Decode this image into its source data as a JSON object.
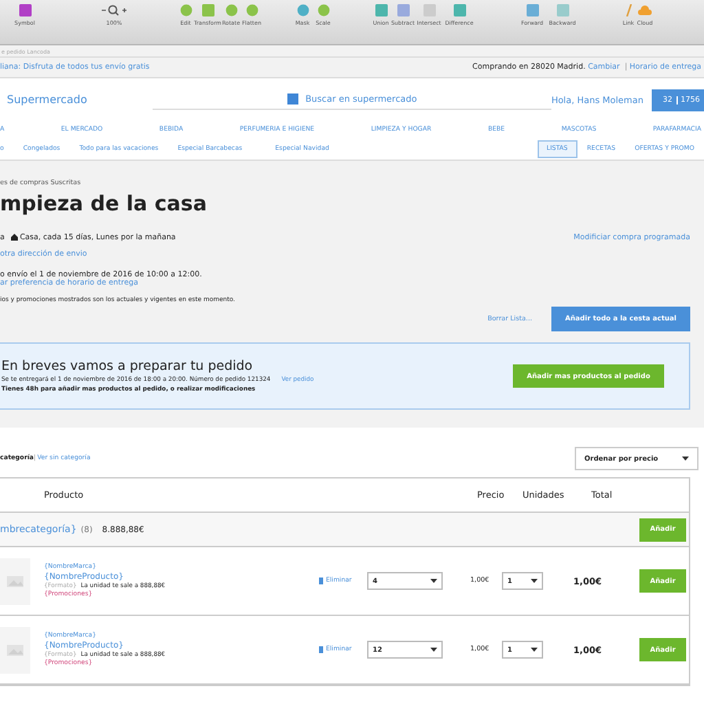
{
  "toolbar": {
    "items": [
      {
        "label": "Symbol"
      },
      {
        "label": "100%"
      },
      {
        "label": "Edit"
      },
      {
        "label": "Transform"
      },
      {
        "label": "Rotate"
      },
      {
        "label": "Flatten"
      },
      {
        "label": "Mask"
      },
      {
        "label": "Scale"
      },
      {
        "label": "Union"
      },
      {
        "label": "Subtract"
      },
      {
        "label": "Intersect"
      },
      {
        "label": "Difference"
      },
      {
        "label": "Forward"
      },
      {
        "label": "Backward"
      },
      {
        "label": "Link"
      },
      {
        "label": "Cloud"
      }
    ]
  },
  "artboard_label": "e pedido Lancoda",
  "promo_bar": {
    "message": "liana: Disfruta de todos tus envío gratis",
    "location": "Comprando en 28020 Madrid.",
    "change_link": "Cambiar",
    "separator": "|",
    "schedule_link": "Horario de entrega"
  },
  "header": {
    "logo": "Supermercado",
    "search": {
      "placeholder": "Buscar en supermercado"
    },
    "greeting": "Hola, Hans Moleman",
    "cart": {
      "count": "32",
      "total": "1756"
    }
  },
  "nav_primary": [
    "A",
    "EL MERCADO",
    "BEBIDA",
    "PERFUMERIA E HIGIENE",
    "LIMPIEZA Y HOGAR",
    "BEBE",
    "MASCOTAS",
    "PARAFARMACIA"
  ],
  "nav_secondary": {
    "left": [
      "o",
      "Congelados",
      "Todo para las vacaciones",
      "Especial Barcabecas",
      "Especial Navidad"
    ],
    "tabs": [
      {
        "label": "LISTAS",
        "selected": true
      },
      {
        "label": "RECETAS",
        "selected": false
      },
      {
        "label": "OFERTAS Y PROMO",
        "selected": false
      }
    ]
  },
  "list": {
    "breadcrumb": "es de compras Suscritas",
    "title": "mpieza de la casa",
    "schedule_prefix": "a",
    "schedule": "Casa, cada 15 días, Lunes por la mañana",
    "address_link": "otra dirección de envio",
    "modify_link": "Modificiar compra programada",
    "next_delivery": "o envío el 1 de noviembre de 2016 de 10:00 a 12:00.",
    "preference_link": "ar preferencia de horario de entrega",
    "disclaimer": "ios y promociones mostrados son los actuales y vigentes en este momento.",
    "clear_link": "Borrar Lista...",
    "add_all_button": "Añadir todo a la cesta actual"
  },
  "notice": {
    "title": "En breves vamos a preparar tu pedido",
    "detail": "Se te entregará el 1 de noviembre de 2016 de 18:00 a 20:00. Número de pedido 121324",
    "order_link": "Ver pedido",
    "note": "Tienes 48h para añadir mas productos al pedido, o realizar modificaciones",
    "button": "Añadir mas productos al pedido"
  },
  "filter": {
    "current": "categoría",
    "separator": "|",
    "other_link": "Ver sin categoría",
    "sort": "Ordenar por precio"
  },
  "table": {
    "columns": [
      "Producto",
      "Precio",
      "Unidades",
      "Total"
    ],
    "category": {
      "name": "mbrecategoría}",
      "count": "(8)",
      "total": "8.888,88€",
      "button": "Añadir"
    },
    "rows": [
      {
        "brand": "{NombreMarca}",
        "product": "{NombreProducto}",
        "format": "{Formato}",
        "unit_price": "La unidad te sale a 888,88€",
        "promotions": "{Promociones}",
        "remove": "Eliminar",
        "list_qty": "4",
        "price": "1,00€",
        "units": "1",
        "total": "1,00€",
        "button": "Añadir"
      },
      {
        "brand": "{NombreMarca}",
        "product": "{NombreProducto}",
        "format": "{Formato}",
        "unit_price": "La unidad te sale a 888,88€",
        "promotions": "{Promociones}",
        "remove": "Eliminar",
        "list_qty": "12",
        "price": "1,00€",
        "units": "1",
        "total": "1,00€",
        "button": "Añadir"
      }
    ]
  }
}
